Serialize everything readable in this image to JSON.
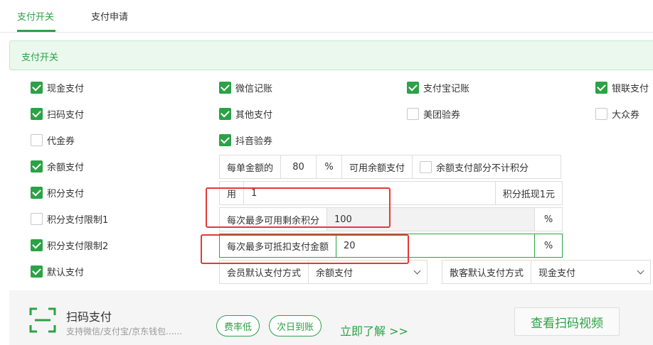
{
  "tabs": [
    {
      "label": "支付开关"
    },
    {
      "label": "支付申请"
    }
  ],
  "section": {
    "title": "支付开关"
  },
  "checkboxes": {
    "cash": {
      "label": "现金支付",
      "checked": true
    },
    "wechat": {
      "label": "微信记账",
      "checked": true
    },
    "alipay": {
      "label": "支付宝记账",
      "checked": true
    },
    "unionpay": {
      "label": "银联支付",
      "checked": true
    },
    "scan": {
      "label": "扫码支付",
      "checked": true
    },
    "other": {
      "label": "其他支付",
      "checked": true
    },
    "meituan": {
      "label": "美团验券",
      "checked": false
    },
    "dianping": {
      "label": "大众券",
      "checked": false
    },
    "voucher": {
      "label": "代金券",
      "checked": false
    },
    "douyin": {
      "label": "抖音验券",
      "checked": true
    },
    "balance": {
      "label": "余额支付",
      "checked": true
    },
    "points": {
      "label": "积分支付",
      "checked": true
    },
    "points_limit1": {
      "label": "积分支付限制1",
      "checked": false
    },
    "points_limit2": {
      "label": "积分支付限制2",
      "checked": true
    },
    "default": {
      "label": "默认支付",
      "checked": true
    }
  },
  "balance_row": {
    "prefix": "每单金额的",
    "value": "80",
    "unit": "%",
    "suffix": "可用余额支付",
    "no_points_label": "余额支付部分不计积分",
    "no_points_checked": false
  },
  "points_row": {
    "prefix": "用",
    "value": "1",
    "suffix": "积分抵现1元"
  },
  "limit1_row": {
    "label": "每次最多可用剩余积分",
    "value": "100",
    "unit": "%"
  },
  "limit2_row": {
    "label": "每次最多可抵扣支付金额",
    "value": "20",
    "unit": "%"
  },
  "default_row": {
    "member_label": "会员默认支付方式",
    "member_value": "余额支付",
    "guest_label": "散客默认支付方式",
    "guest_value": "现金支付"
  },
  "footer": {
    "title": "扫码支付",
    "subtitle": "支持微信/支付宝/京东钱包......",
    "badge1": "费率低",
    "badge2": "次日到账",
    "learn_more": "立即了解 >>",
    "video_button": "查看扫码视频"
  },
  "colors": {
    "accent": "#2ba245",
    "highlight": "#e53935"
  }
}
